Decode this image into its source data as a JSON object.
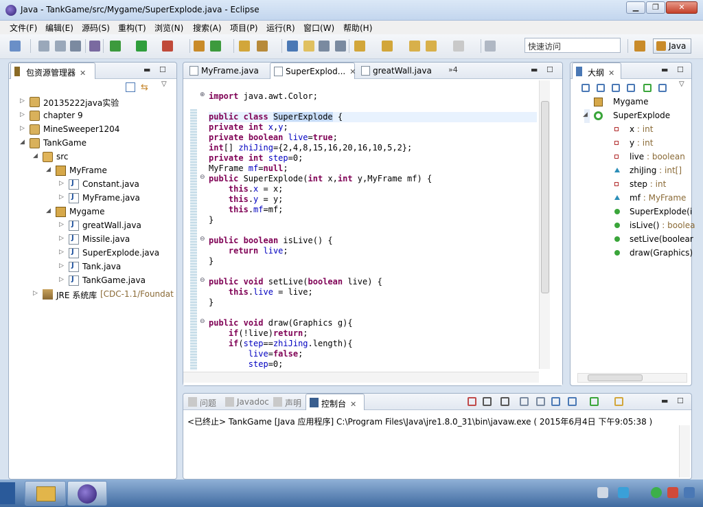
{
  "window": {
    "title": "Java  -  TankGame/src/Mygame/SuperExplode.java  -  Eclipse"
  },
  "menu": [
    "文件(F)",
    "编辑(E)",
    "源码(S)",
    "重构(T)",
    "浏览(N)",
    "搜索(A)",
    "项目(P)",
    "运行(R)",
    "窗口(W)",
    "帮助(H)"
  ],
  "toolbar": {
    "quick_access": "快速访问",
    "perspective": "Java"
  },
  "explorer": {
    "title": "包资源管理器",
    "items": [
      {
        "label": "20135222java实验",
        "level": 0,
        "arrow": "▷",
        "icon": "project"
      },
      {
        "label": "chapter 9",
        "level": 0,
        "arrow": "▷",
        "icon": "project"
      },
      {
        "label": "MineSweeper1204",
        "level": 0,
        "arrow": "▷",
        "icon": "project"
      },
      {
        "label": "TankGame",
        "level": 0,
        "arrow": "◢",
        "icon": "project"
      },
      {
        "label": "src",
        "level": 1,
        "arrow": "◢",
        "icon": "src"
      },
      {
        "label": "MyFrame",
        "level": 2,
        "arrow": "◢",
        "icon": "pkg"
      },
      {
        "label": "Constant.java",
        "level": 3,
        "arrow": "▷",
        "icon": "java"
      },
      {
        "label": "MyFrame.java",
        "level": 3,
        "arrow": "▷",
        "icon": "java"
      },
      {
        "label": "Mygame",
        "level": 2,
        "arrow": "◢",
        "icon": "pkg"
      },
      {
        "label": "greatWall.java",
        "level": 3,
        "arrow": "▷",
        "icon": "java"
      },
      {
        "label": "Missile.java",
        "level": 3,
        "arrow": "▷",
        "icon": "java"
      },
      {
        "label": "SuperExplode.java",
        "level": 3,
        "arrow": "▷",
        "icon": "java"
      },
      {
        "label": "Tank.java",
        "level": 3,
        "arrow": "▷",
        "icon": "java"
      },
      {
        "label": "TankGame.java",
        "level": 3,
        "arrow": "▷",
        "icon": "java"
      },
      {
        "label": "JRE 系统库",
        "suffix": "[CDC-1.1/Foundat",
        "level": 1,
        "arrow": "▷",
        "icon": "lib"
      }
    ]
  },
  "editor": {
    "tabs": [
      {
        "label": "MyFrame.java"
      },
      {
        "label": "SuperExplod...",
        "active": true
      },
      {
        "label": "greatWall.java"
      }
    ],
    "overflow": "»4",
    "lines": [
      "import java.awt.Color;",
      "",
      "public class SuperExplode {",
      "private int x,y;",
      "private boolean live=true;",
      "int[] zhiJing={2,4,8,15,16,20,16,10,5,2};",
      "private int step=0;",
      "MyFrame mf=null;",
      "public SuperExplode(int x,int y,MyFrame mf) {",
      "    this.x = x;",
      "    this.y = y;",
      "    this.mf=mf;",
      "}",
      "",
      "public boolean isLive() {",
      "    return live;",
      "}",
      "",
      "public void setLive(boolean live) {",
      "    this.live = live;",
      "}",
      "",
      "public void draw(Graphics g){",
      "    if(!live)return;",
      "    if(step==zhiJing.length){",
      "        live=false;",
      "        step=0;"
    ]
  },
  "outline": {
    "title": "大纲",
    "items": [
      {
        "name": "Mygame",
        "type": "",
        "kind": "pkg",
        "level": 0
      },
      {
        "name": "SuperExplode",
        "type": "",
        "kind": "class",
        "level": 0
      },
      {
        "name": "x",
        "type": " : int",
        "kind": "priv",
        "level": 1
      },
      {
        "name": "y",
        "type": " : int",
        "kind": "priv",
        "level": 1
      },
      {
        "name": "live",
        "type": " : boolean",
        "kind": "priv",
        "level": 1
      },
      {
        "name": "zhiJing",
        "type": " : int[]",
        "kind": "def",
        "level": 1
      },
      {
        "name": "step",
        "type": " : int",
        "kind": "priv",
        "level": 1
      },
      {
        "name": "mf",
        "type": " : MyFrame",
        "kind": "def",
        "level": 1
      },
      {
        "name": "SuperExplode(i",
        "type": "",
        "kind": "pub",
        "level": 1
      },
      {
        "name": "isLive()",
        "type": " : boolea",
        "kind": "pub",
        "level": 1
      },
      {
        "name": "setLive(boolear",
        "type": "",
        "kind": "pub",
        "level": 1
      },
      {
        "name": "draw(Graphics)",
        "type": "",
        "kind": "pub",
        "level": 1
      }
    ]
  },
  "console": {
    "tabs": [
      {
        "label": "问题"
      },
      {
        "label": "Javadoc"
      },
      {
        "label": "声明"
      },
      {
        "label": "控制台",
        "active": true
      }
    ],
    "text": "<已终止> TankGame [Java 应用程序] C:\\Program Files\\Java\\jre1.8.0_31\\bin\\javaw.exe ( 2015年6月4日 下午9:05:38 )"
  }
}
